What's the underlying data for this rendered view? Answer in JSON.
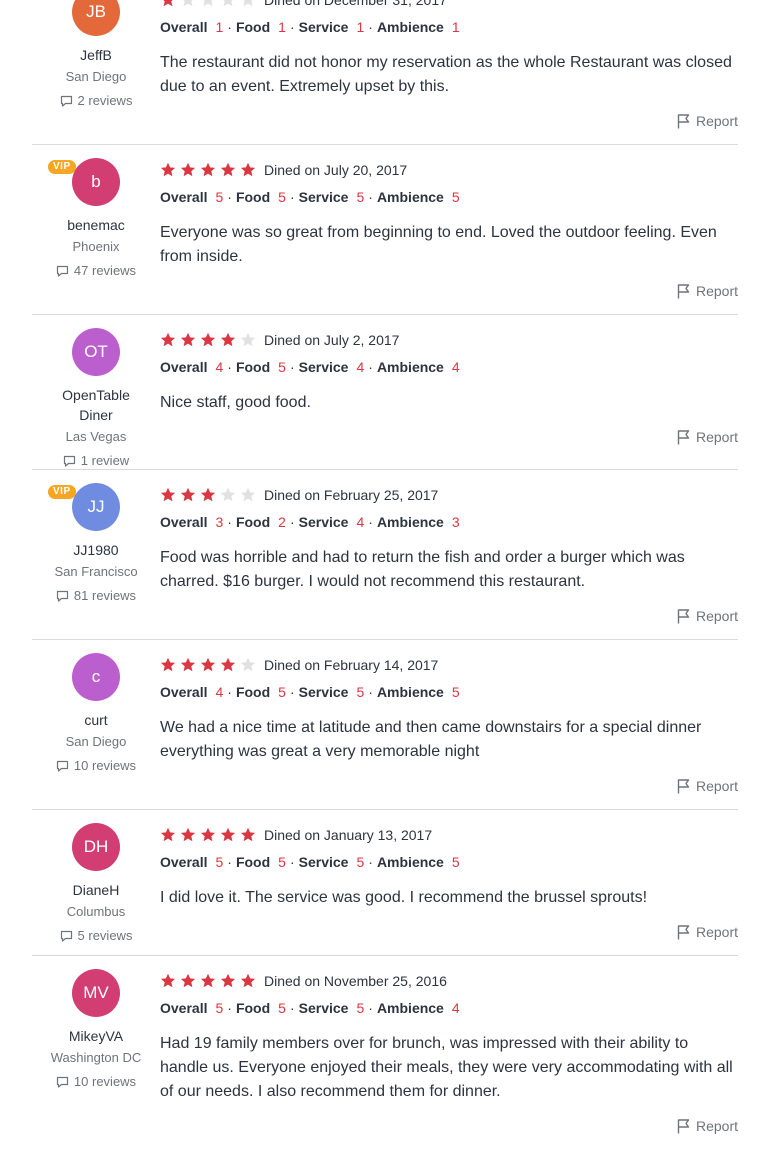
{
  "colors": {
    "star_filled": "#da3743",
    "star_empty": "#e1e1e1",
    "rating_value": "#da3743",
    "vip_badge": "#f5a623"
  },
  "labels": {
    "overall": "Overall",
    "food": "Food",
    "service": "Service",
    "ambience": "Ambience",
    "report": "Report",
    "vip": "VIP"
  },
  "reviews": [
    {
      "initials": "JB",
      "avatar_color": "#e3683a",
      "vip": false,
      "name": "JeffB",
      "location": "San Diego",
      "review_count": "2 reviews",
      "stars": 1,
      "dined": "Dined on December 31, 2017",
      "overall": "1",
      "food": "1",
      "service": "1",
      "ambience": "1",
      "text": "The restaurant did not honor my reservation as the whole Restaurant was closed due to an event. Extremely upset by this."
    },
    {
      "initials": "b",
      "avatar_color": "#d23d72",
      "vip": true,
      "name": "benemac",
      "location": "Phoenix",
      "review_count": "47 reviews",
      "stars": 5,
      "dined": "Dined on July 20, 2017",
      "overall": "5",
      "food": "5",
      "service": "5",
      "ambience": "5",
      "text": "Everyone was so great from beginning to end. Loved the outdoor feeling. Even from inside."
    },
    {
      "initials": "OT",
      "avatar_color": "#bc5fce",
      "vip": false,
      "name": "OpenTable Diner",
      "location": "Las Vegas",
      "review_count": "1 review",
      "stars": 4,
      "dined": "Dined on July 2, 2017",
      "overall": "4",
      "food": "5",
      "service": "4",
      "ambience": "4",
      "text": "Nice staff, good food."
    },
    {
      "initials": "JJ",
      "avatar_color": "#6f8ce0",
      "vip": true,
      "name": "JJ1980",
      "location": "San Francisco",
      "review_count": "81 reviews",
      "stars": 3,
      "dined": "Dined on February 25, 2017",
      "overall": "3",
      "food": "2",
      "service": "4",
      "ambience": "3",
      "text": "Food was horrible and had to return the fish and order a burger which was charred. $16 burger. I would not recommend this restaurant."
    },
    {
      "initials": "c",
      "avatar_color": "#bc5fce",
      "vip": false,
      "name": "curt",
      "location": "San Diego",
      "review_count": "10 reviews",
      "stars": 4,
      "dined": "Dined on February 14, 2017",
      "overall": "4",
      "food": "5",
      "service": "5",
      "ambience": "5",
      "text": "We had a nice time at latitude and then came downstairs for a special dinner everything was great a very memorable night"
    },
    {
      "initials": "DH",
      "avatar_color": "#d23d72",
      "vip": false,
      "name": "DianeH",
      "location": "Columbus",
      "review_count": "5 reviews",
      "stars": 5,
      "dined": "Dined on January 13, 2017",
      "overall": "5",
      "food": "5",
      "service": "5",
      "ambience": "5",
      "text": "I did love it. The service was good. I recommend the brussel sprouts!"
    },
    {
      "initials": "MV",
      "avatar_color": "#d23d72",
      "vip": false,
      "name": "MikeyVA",
      "location": "Washington DC",
      "review_count": "10 reviews",
      "stars": 5,
      "dined": "Dined on November 25, 2016",
      "overall": "5",
      "food": "5",
      "service": "5",
      "ambience": "4",
      "text": "Had 19 family members over for brunch, was impressed with their ability to handle us. Everyone enjoyed their meals, they were very accommodating with all of our needs. I also recommend them for dinner."
    }
  ]
}
